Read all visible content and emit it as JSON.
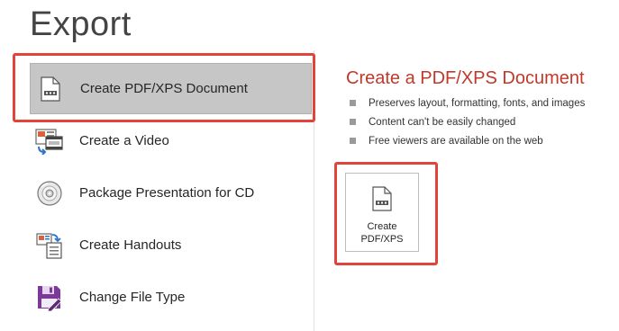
{
  "page": {
    "title": "Export"
  },
  "sidebar": {
    "items": [
      {
        "label": "Create PDF/XPS Document",
        "icon": "pdf-document-icon",
        "selected": true
      },
      {
        "label": "Create a Video",
        "icon": "video-icon",
        "selected": false
      },
      {
        "label": "Package Presentation for CD",
        "icon": "cd-icon",
        "selected": false
      },
      {
        "label": "Create Handouts",
        "icon": "handouts-icon",
        "selected": false
      },
      {
        "label": "Change File Type",
        "icon": "change-file-type-icon",
        "selected": false
      }
    ]
  },
  "details": {
    "title": "Create a PDF/XPS Document",
    "bullets": [
      "Preserves layout, formatting, fonts, and images",
      "Content can't be easily changed",
      "Free viewers are available on the web"
    ],
    "button": {
      "line1": "Create",
      "line2": "PDF/XPS",
      "icon": "pdf-document-icon"
    }
  },
  "colors": {
    "accent_title": "#c0392b",
    "highlight": "#e0443a",
    "selected_bg": "#c6c6c6"
  }
}
